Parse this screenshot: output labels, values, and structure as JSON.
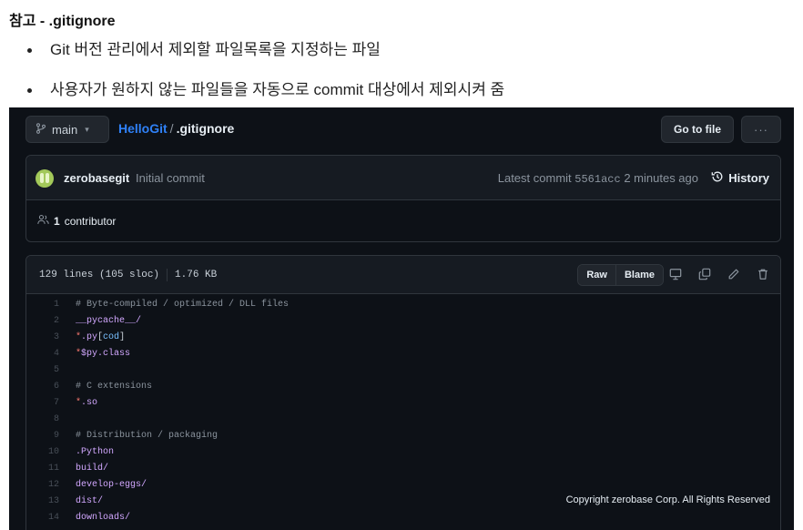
{
  "note": {
    "title": "참고 - .gitignore",
    "bullets": [
      "Git 버전 관리에서 제외할 파일목록을 지정하는 파일",
      "사용자가 원하지 않는 파일들을 자동으로 commit 대상에서 제외시켜 줌"
    ]
  },
  "header": {
    "branch": "main",
    "repo": "HelloGit",
    "separator": "/",
    "file": ".gitignore",
    "goto_file": "Go to file",
    "more": "···"
  },
  "commit": {
    "author": "zerobasegit",
    "message": "Initial commit",
    "latest_label": "Latest commit",
    "sha": "5561acc",
    "time": "2 minutes ago",
    "history": "History",
    "contributors_count": "1",
    "contributors_label": "contributor"
  },
  "file": {
    "lines_info": "129 lines (105 sloc)",
    "size": "1.76 KB",
    "raw": "Raw",
    "blame": "Blame"
  },
  "code_lines": [
    {
      "n": "1",
      "tokens": [
        {
          "t": "# Byte-compiled / optimized / DLL files",
          "c": "comment"
        }
      ]
    },
    {
      "n": "2",
      "tokens": [
        {
          "t": "__pycache__/",
          "c": "purple"
        }
      ]
    },
    {
      "n": "3",
      "tokens": [
        {
          "t": "*",
          "c": "keyword"
        },
        {
          "t": ".py",
          "c": "purple"
        },
        {
          "t": "[",
          "c": "plain"
        },
        {
          "t": "cod",
          "c": "blue"
        },
        {
          "t": "]",
          "c": "plain"
        }
      ]
    },
    {
      "n": "4",
      "tokens": [
        {
          "t": "*",
          "c": "keyword"
        },
        {
          "t": "$py.class",
          "c": "purple"
        }
      ]
    },
    {
      "n": "5",
      "tokens": []
    },
    {
      "n": "6",
      "tokens": [
        {
          "t": "# C extensions",
          "c": "comment"
        }
      ]
    },
    {
      "n": "7",
      "tokens": [
        {
          "t": "*",
          "c": "keyword"
        },
        {
          "t": ".so",
          "c": "purple"
        }
      ]
    },
    {
      "n": "8",
      "tokens": []
    },
    {
      "n": "9",
      "tokens": [
        {
          "t": "# Distribution / packaging",
          "c": "comment"
        }
      ]
    },
    {
      "n": "10",
      "tokens": [
        {
          "t": ".Python",
          "c": "purple"
        }
      ]
    },
    {
      "n": "11",
      "tokens": [
        {
          "t": "build/",
          "c": "purple"
        }
      ]
    },
    {
      "n": "12",
      "tokens": [
        {
          "t": "develop-eggs/",
          "c": "purple"
        }
      ]
    },
    {
      "n": "13",
      "tokens": [
        {
          "t": "dist/",
          "c": "purple"
        }
      ]
    },
    {
      "n": "14",
      "tokens": [
        {
          "t": "downloads/",
          "c": "purple"
        }
      ]
    }
  ],
  "copyright": "Copyright zerobase Corp. All Rights Reserved",
  "colors": {
    "background": "#0d1117",
    "panel": "#161b22",
    "border": "#30363d",
    "link": "#2f81f7",
    "comment": "#8b949e",
    "keyword": "#ff7b72",
    "purple": "#d2a8ff",
    "blue": "#79c0ff"
  },
  "icons": [
    "branch-icon",
    "chevron-down-icon",
    "kebab-icon",
    "avatar",
    "history-icon",
    "people-icon",
    "desktop-icon",
    "copy-icon",
    "pencil-icon",
    "trash-icon"
  ]
}
